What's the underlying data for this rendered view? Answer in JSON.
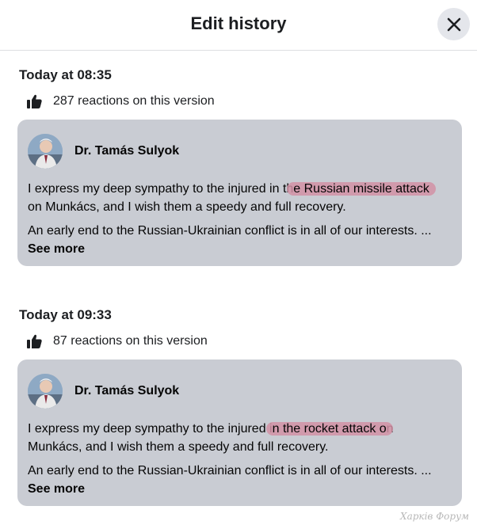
{
  "header": {
    "title": "Edit history",
    "close_icon": "close-icon"
  },
  "versions": [
    {
      "timestamp": "Today at 08:35",
      "reactions_label": "287 reactions on this version",
      "author": "Dr. Tamás Sulyok",
      "p1_before": "I express my deep sympathy to the injured in th",
      "p1_highlight": "e Russian missile attack",
      "p1_line2": "on Munkács, and I wish them a speedy and full recovery.",
      "p2": "An early end to the Russian-Ukrainian conflict is in all of our interests. ...",
      "see_more": "See more"
    },
    {
      "timestamp": "Today at 09:33",
      "reactions_label": "87 reactions on this version",
      "author": "Dr. Tamás Sulyok",
      "p1_before": "I express my deep sympathy to the injured i",
      "p1_highlight": "n the rocket attack o",
      "p1_after": "n",
      "p1_line2": "Munkács, and I wish them a speedy and full recovery.",
      "p2": "An early end to the Russian-Ukrainian conflict is in all of our interests. ...",
      "see_more": "See more"
    }
  ],
  "watermark": "Харків Форум",
  "colors": {
    "card_bg": "#c9ccd3",
    "highlight": "#d291a5",
    "close_bg": "#e4e6eb"
  }
}
